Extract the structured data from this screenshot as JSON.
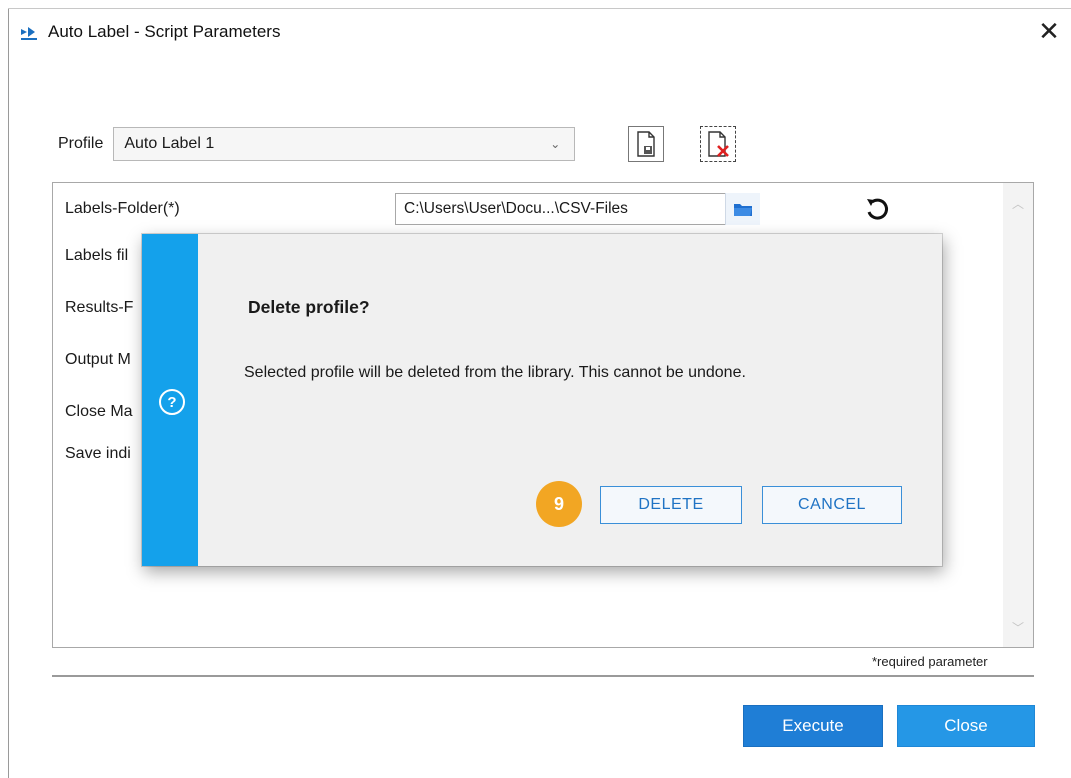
{
  "window": {
    "title": "Auto Label - Script Parameters",
    "close_glyph": "✕"
  },
  "profile": {
    "label": "Profile",
    "selected": "Auto Label 1",
    "save_icon": "save-profile-icon",
    "delete_icon": "delete-profile-icon"
  },
  "params": {
    "rows": [
      {
        "label": "Labels-Folder(*)"
      },
      {
        "label": "Labels fil"
      },
      {
        "label": "Results-F"
      },
      {
        "label": "Output M"
      },
      {
        "label": "Close Ma"
      },
      {
        "label": "Save indi"
      }
    ],
    "folder_value": "C:\\Users\\User\\Docu...\\CSV-Files",
    "required_note": "*required parameter"
  },
  "footer": {
    "execute_label": "Execute",
    "close_label": "Close"
  },
  "dialog": {
    "title": "Delete profile?",
    "message": "Selected profile will be deleted from the library. This cannot be undone.",
    "delete_label": "DELETE",
    "cancel_label": "CANCEL",
    "step_badge": "9"
  },
  "colors": {
    "accent": "#14a1eb",
    "primary_button": "#1f7ed6",
    "badge": "#f2a623"
  }
}
